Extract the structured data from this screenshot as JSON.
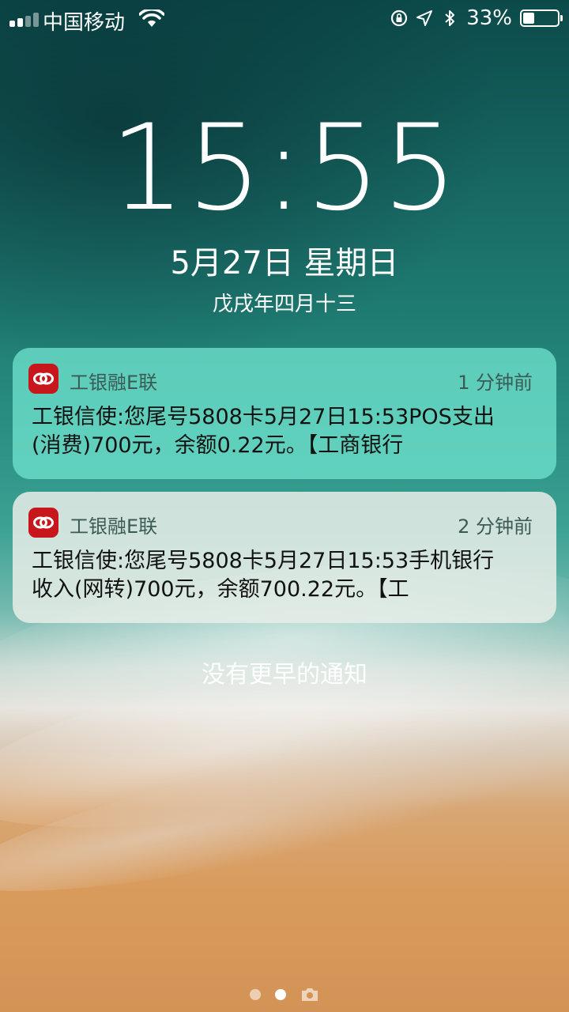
{
  "status_bar": {
    "carrier": "中国移动",
    "battery_percent_label": "33%",
    "battery_level": 0.33,
    "signal_bars_active": 2,
    "signal_bars_total": 4,
    "icons": [
      "signal-icon",
      "wifi-icon",
      "rotation-lock-icon",
      "location-arrow-icon",
      "bluetooth-icon",
      "battery-icon"
    ]
  },
  "lock_screen": {
    "time": "15:55",
    "date": "5月27日 星期日",
    "lunar_date": "戊戌年四月十三"
  },
  "notifications": [
    {
      "app_name": "工银融E联",
      "time_ago": "1 分钟前",
      "body": "工银信使:您尾号5808卡5月27日15:53POS支出\n(消费)700元，余额0.22元。【工商银行",
      "icon": "icbc-app-icon",
      "icon_color": "#c8161d"
    },
    {
      "app_name": "工银融E联",
      "time_ago": "2 分钟前",
      "body": "工银信使:您尾号5808卡5月27日15:53手机银行\n收入(网转)700元，余额700.22元。【工",
      "icon": "icbc-app-icon",
      "icon_color": "#c8161d"
    }
  ],
  "no_older_notifications": "没有更早的通知",
  "page_indicator": {
    "pages": 2,
    "active_index": 1,
    "camera_icon": "camera-icon"
  }
}
